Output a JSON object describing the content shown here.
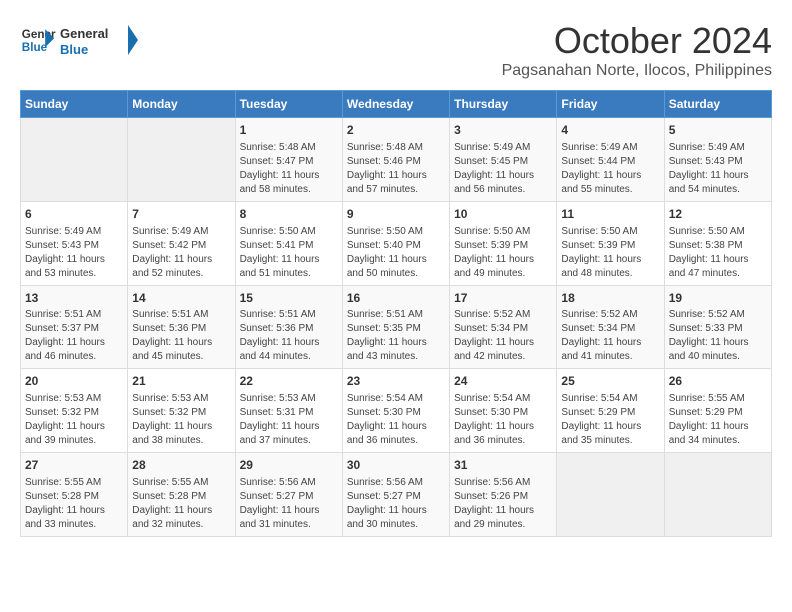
{
  "header": {
    "logo_line1": "General",
    "logo_line2": "Blue",
    "month": "October 2024",
    "location": "Pagsanahan Norte, Ilocos, Philippines"
  },
  "weekdays": [
    "Sunday",
    "Monday",
    "Tuesday",
    "Wednesday",
    "Thursday",
    "Friday",
    "Saturday"
  ],
  "weeks": [
    [
      {
        "day": "",
        "empty": true
      },
      {
        "day": "",
        "empty": true
      },
      {
        "day": "1",
        "sunrise": "5:48 AM",
        "sunset": "5:47 PM",
        "daylight": "11 hours and 58 minutes."
      },
      {
        "day": "2",
        "sunrise": "5:48 AM",
        "sunset": "5:46 PM",
        "daylight": "11 hours and 57 minutes."
      },
      {
        "day": "3",
        "sunrise": "5:49 AM",
        "sunset": "5:45 PM",
        "daylight": "11 hours and 56 minutes."
      },
      {
        "day": "4",
        "sunrise": "5:49 AM",
        "sunset": "5:44 PM",
        "daylight": "11 hours and 55 minutes."
      },
      {
        "day": "5",
        "sunrise": "5:49 AM",
        "sunset": "5:43 PM",
        "daylight": "11 hours and 54 minutes."
      }
    ],
    [
      {
        "day": "6",
        "sunrise": "5:49 AM",
        "sunset": "5:43 PM",
        "daylight": "11 hours and 53 minutes."
      },
      {
        "day": "7",
        "sunrise": "5:49 AM",
        "sunset": "5:42 PM",
        "daylight": "11 hours and 52 minutes."
      },
      {
        "day": "8",
        "sunrise": "5:50 AM",
        "sunset": "5:41 PM",
        "daylight": "11 hours and 51 minutes."
      },
      {
        "day": "9",
        "sunrise": "5:50 AM",
        "sunset": "5:40 PM",
        "daylight": "11 hours and 50 minutes."
      },
      {
        "day": "10",
        "sunrise": "5:50 AM",
        "sunset": "5:39 PM",
        "daylight": "11 hours and 49 minutes."
      },
      {
        "day": "11",
        "sunrise": "5:50 AM",
        "sunset": "5:39 PM",
        "daylight": "11 hours and 48 minutes."
      },
      {
        "day": "12",
        "sunrise": "5:50 AM",
        "sunset": "5:38 PM",
        "daylight": "11 hours and 47 minutes."
      }
    ],
    [
      {
        "day": "13",
        "sunrise": "5:51 AM",
        "sunset": "5:37 PM",
        "daylight": "11 hours and 46 minutes."
      },
      {
        "day": "14",
        "sunrise": "5:51 AM",
        "sunset": "5:36 PM",
        "daylight": "11 hours and 45 minutes."
      },
      {
        "day": "15",
        "sunrise": "5:51 AM",
        "sunset": "5:36 PM",
        "daylight": "11 hours and 44 minutes."
      },
      {
        "day": "16",
        "sunrise": "5:51 AM",
        "sunset": "5:35 PM",
        "daylight": "11 hours and 43 minutes."
      },
      {
        "day": "17",
        "sunrise": "5:52 AM",
        "sunset": "5:34 PM",
        "daylight": "11 hours and 42 minutes."
      },
      {
        "day": "18",
        "sunrise": "5:52 AM",
        "sunset": "5:34 PM",
        "daylight": "11 hours and 41 minutes."
      },
      {
        "day": "19",
        "sunrise": "5:52 AM",
        "sunset": "5:33 PM",
        "daylight": "11 hours and 40 minutes."
      }
    ],
    [
      {
        "day": "20",
        "sunrise": "5:53 AM",
        "sunset": "5:32 PM",
        "daylight": "11 hours and 39 minutes."
      },
      {
        "day": "21",
        "sunrise": "5:53 AM",
        "sunset": "5:32 PM",
        "daylight": "11 hours and 38 minutes."
      },
      {
        "day": "22",
        "sunrise": "5:53 AM",
        "sunset": "5:31 PM",
        "daylight": "11 hours and 37 minutes."
      },
      {
        "day": "23",
        "sunrise": "5:54 AM",
        "sunset": "5:30 PM",
        "daylight": "11 hours and 36 minutes."
      },
      {
        "day": "24",
        "sunrise": "5:54 AM",
        "sunset": "5:30 PM",
        "daylight": "11 hours and 36 minutes."
      },
      {
        "day": "25",
        "sunrise": "5:54 AM",
        "sunset": "5:29 PM",
        "daylight": "11 hours and 35 minutes."
      },
      {
        "day": "26",
        "sunrise": "5:55 AM",
        "sunset": "5:29 PM",
        "daylight": "11 hours and 34 minutes."
      }
    ],
    [
      {
        "day": "27",
        "sunrise": "5:55 AM",
        "sunset": "5:28 PM",
        "daylight": "11 hours and 33 minutes."
      },
      {
        "day": "28",
        "sunrise": "5:55 AM",
        "sunset": "5:28 PM",
        "daylight": "11 hours and 32 minutes."
      },
      {
        "day": "29",
        "sunrise": "5:56 AM",
        "sunset": "5:27 PM",
        "daylight": "11 hours and 31 minutes."
      },
      {
        "day": "30",
        "sunrise": "5:56 AM",
        "sunset": "5:27 PM",
        "daylight": "11 hours and 30 minutes."
      },
      {
        "day": "31",
        "sunrise": "5:56 AM",
        "sunset": "5:26 PM",
        "daylight": "11 hours and 29 minutes."
      },
      {
        "day": "",
        "empty": true
      },
      {
        "day": "",
        "empty": true
      }
    ]
  ],
  "labels": {
    "sunrise": "Sunrise:",
    "sunset": "Sunset:",
    "daylight": "Daylight:"
  }
}
